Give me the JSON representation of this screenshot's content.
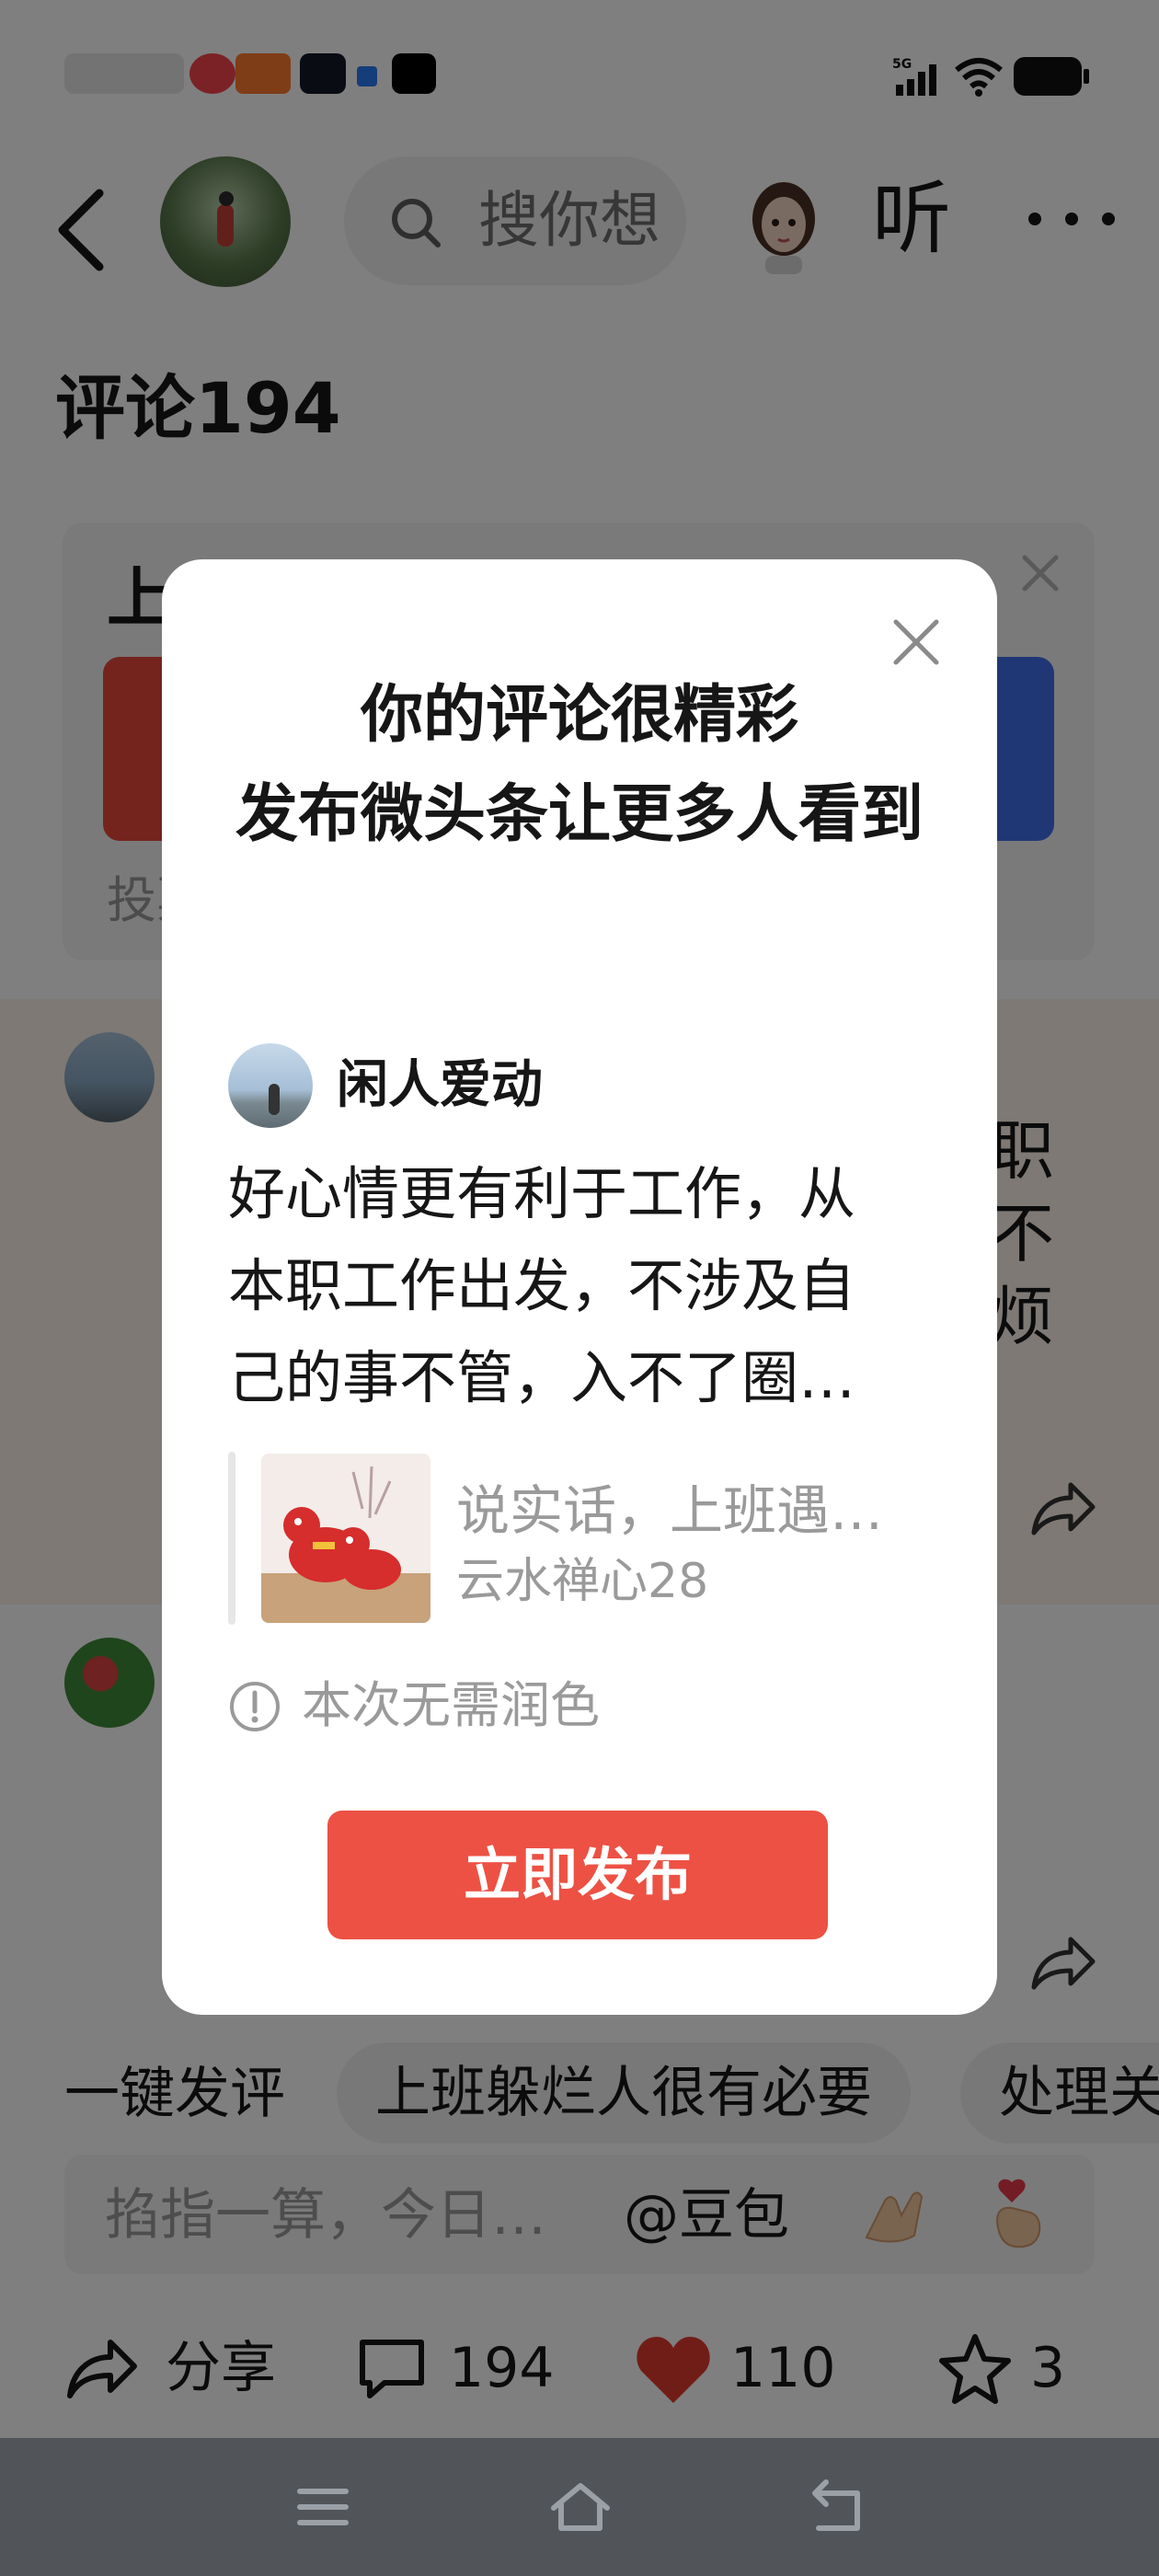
{
  "header": {
    "search_placeholder": "搜你想",
    "listen_label": "听"
  },
  "comments": {
    "title": "评论194",
    "vote_card": {
      "title_partial": "上",
      "footer_partial": "投票"
    },
    "comment1_partial_lines": [
      "职",
      "不",
      "烦"
    ]
  },
  "quick_replies": {
    "label": "一键发评",
    "chips": [
      "上班躲烂人很有必要",
      "处理关"
    ]
  },
  "composer": {
    "placeholder": "掐指一算，今日…",
    "doubao": "@豆包"
  },
  "actions": {
    "share_label": "分享",
    "comment_count": "194",
    "like_count": "110",
    "star_count": "3"
  },
  "modal": {
    "title": "你的评论很精彩\n发布微头条让更多人看到",
    "author_name": "闲人爱动",
    "body_lines": [
      "好心情更有利于工作，从",
      "本职工作出发，不涉及自",
      "己的事不管，入不了圈…"
    ],
    "quote_title": "说实话，上班遇…",
    "quote_author": "云水禅心28",
    "hint": "本次无需润色",
    "publish_label": "立即发布"
  },
  "colors": {
    "accent": "#ec5144",
    "like_heart": "#e33a2f",
    "vote_red": "#e8493a",
    "vote_blue": "#3f6fe8",
    "nav_bar": "#515458"
  },
  "icons": [
    "back-arrow-icon",
    "search-icon",
    "more-icon",
    "close-icon",
    "share-icon",
    "comment-icon",
    "heart-icon",
    "star-icon",
    "info-icon",
    "menu-icon",
    "home-icon",
    "back-nav-icon",
    "wifi-icon",
    "signal-icon",
    "battery-icon"
  ]
}
